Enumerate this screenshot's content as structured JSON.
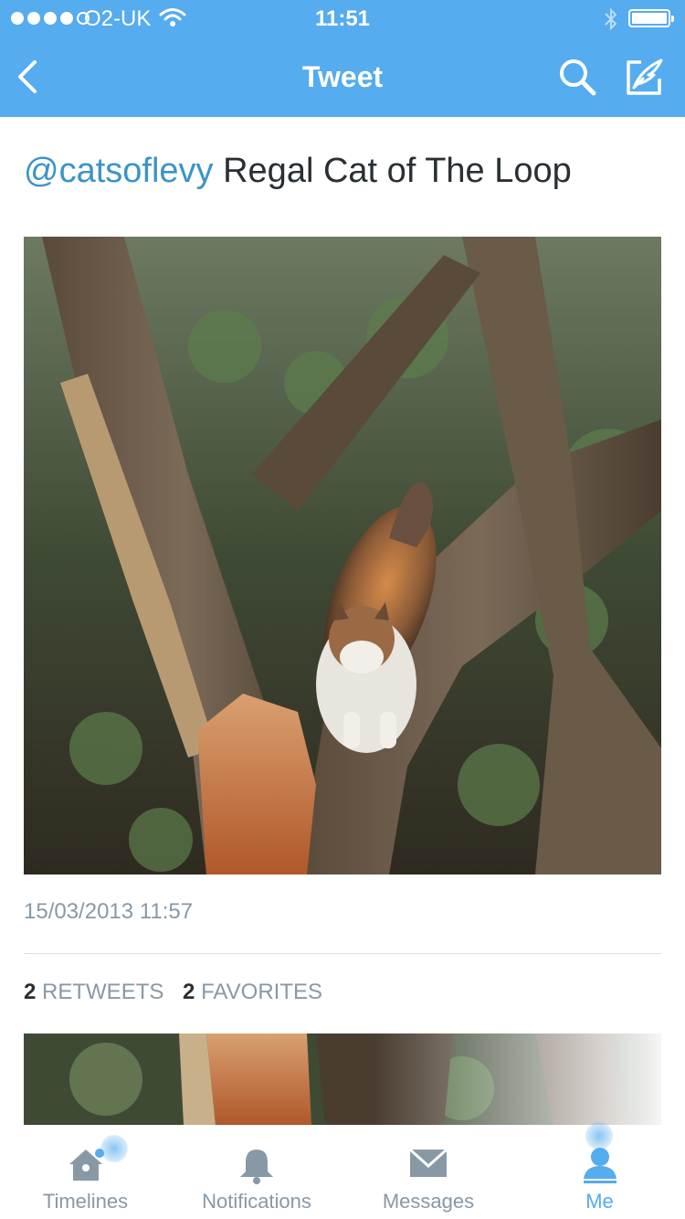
{
  "status_bar": {
    "carrier": "O2-UK",
    "time": "11:51",
    "signal_bars": 4,
    "signal_max": 5,
    "battery_level": 1.0
  },
  "nav": {
    "title": "Tweet",
    "back_icon": "chevron-left-icon",
    "search_icon": "search-icon",
    "compose_icon": "compose-icon"
  },
  "tweet": {
    "mention": "@catsoflevy",
    "text": "Regal Cat of The Loop",
    "timestamp": "15/03/2013 11:57",
    "retweets_count": "2",
    "retweets_label": "RETWEETS",
    "favorites_count": "2",
    "favorites_label": "FAVORITES"
  },
  "tabbar": {
    "items": [
      {
        "label": "Timelines",
        "icon": "home-icon",
        "active": false
      },
      {
        "label": "Notifications",
        "icon": "bell-icon",
        "active": false
      },
      {
        "label": "Messages",
        "icon": "envelope-icon",
        "active": false
      },
      {
        "label": "Me",
        "icon": "person-icon",
        "active": true
      }
    ]
  },
  "colors": {
    "brand": "#55acee",
    "mention": "#3a94c9",
    "muted": "#8899a6",
    "text": "#292f33"
  }
}
